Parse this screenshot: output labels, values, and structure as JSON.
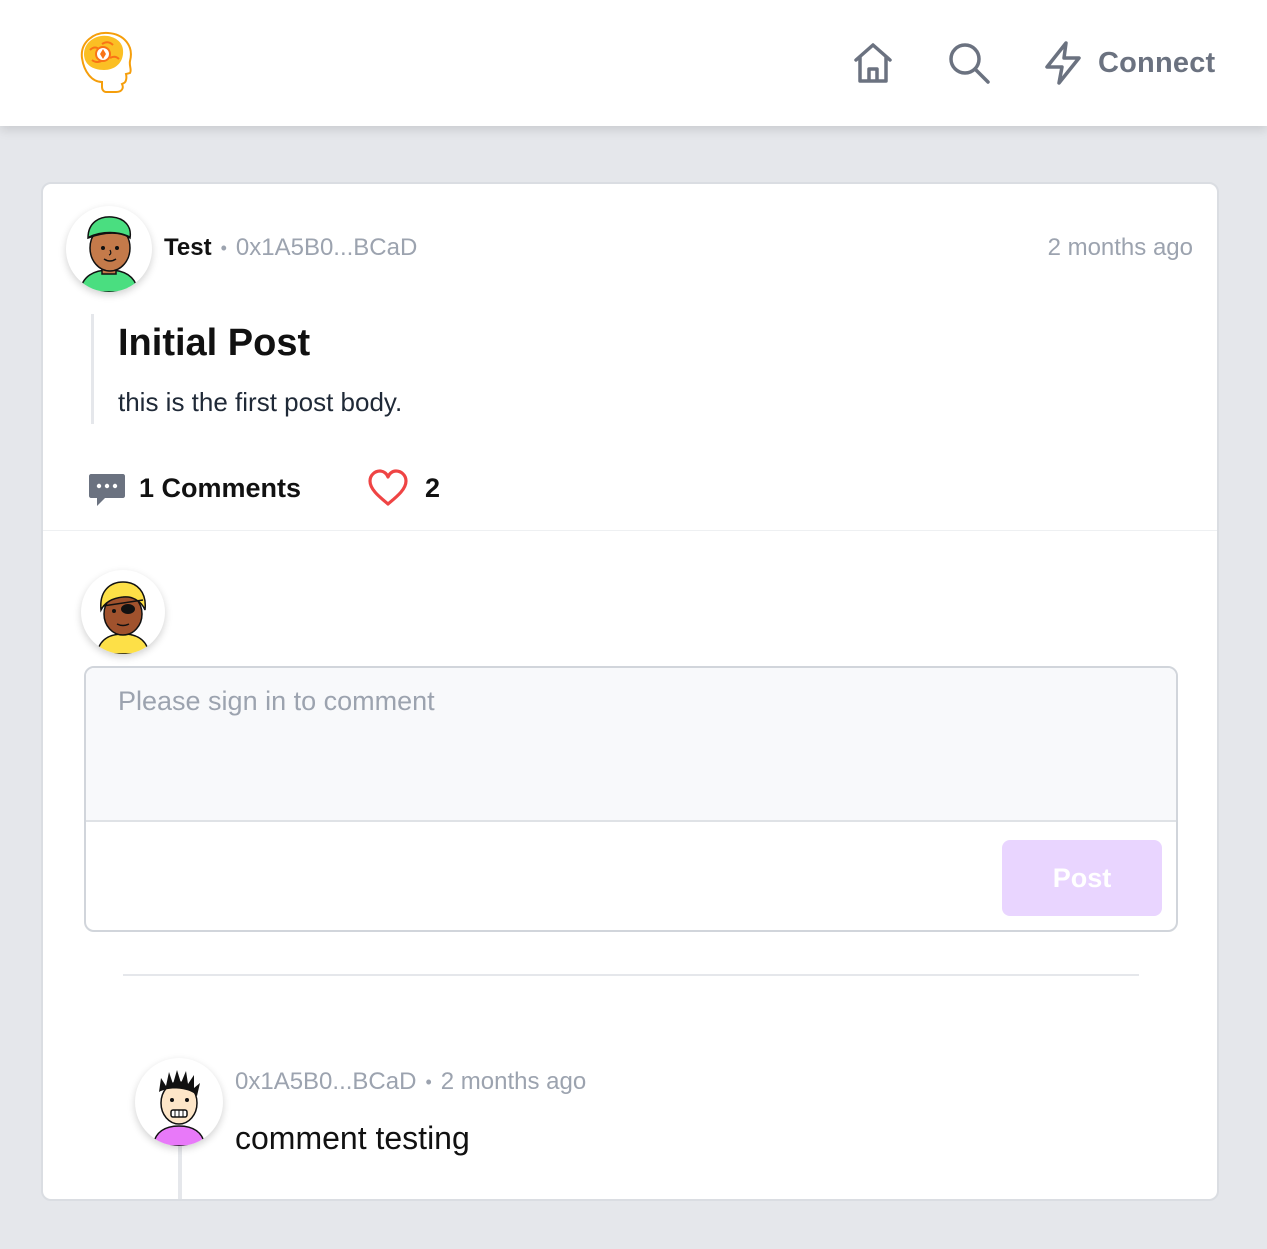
{
  "nav": {
    "connect_label": "Connect",
    "icons": [
      "brain-logo",
      "home-icon",
      "search-icon",
      "lightning-icon"
    ]
  },
  "post": {
    "author": "Test",
    "address": "0x1A5B0...BCaD",
    "time": "2 months ago",
    "title": "Initial Post",
    "body": "this is the first post body.",
    "comments_label": "1 Comments",
    "likes": "2"
  },
  "composer": {
    "placeholder": "Please sign in to comment",
    "post_label": "Post"
  },
  "comments": [
    {
      "address": "0x1A5B0...BCaD",
      "time": "2 months ago",
      "text": "comment testing"
    }
  ],
  "colors": {
    "background": "#e5e7eb",
    "muted_text": "#9ca3af",
    "heart": "#ef4444",
    "post_button": "#e9d5ff",
    "logo_orange": "#f59e0b"
  }
}
